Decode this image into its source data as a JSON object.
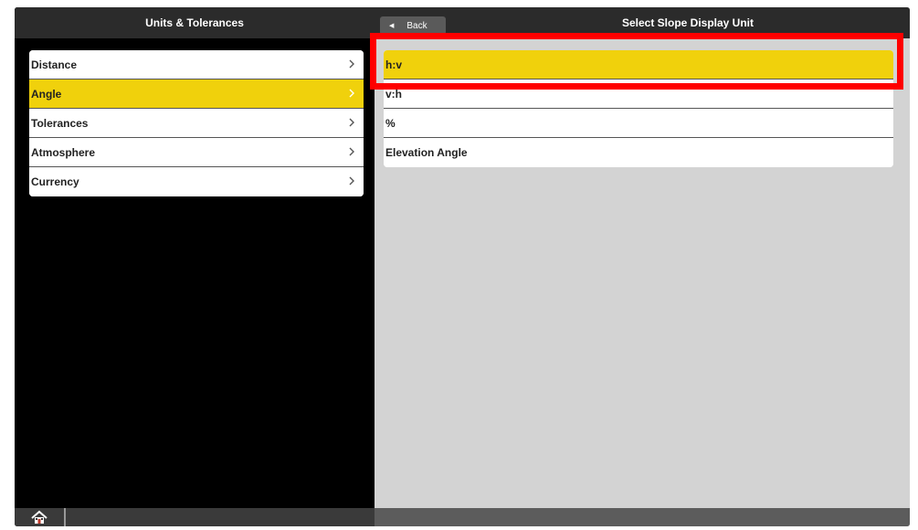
{
  "colors": {
    "selected": "#f0d10c",
    "header_bg": "#2b2b2b",
    "right_bg": "#d3d3d3",
    "highlight": "#ff0000"
  },
  "left_pane": {
    "title": "Units & Tolerances",
    "items": [
      {
        "label": "Distance",
        "selected": false
      },
      {
        "label": "Angle",
        "selected": true
      },
      {
        "label": "Tolerances",
        "selected": false
      },
      {
        "label": "Atmosphere",
        "selected": false
      },
      {
        "label": "Currency",
        "selected": false
      }
    ],
    "footer": {
      "home_icon": "home-icon"
    }
  },
  "right_pane": {
    "title": "Select Slope Display Unit",
    "back_label": "Back",
    "items": [
      {
        "label": "h:v",
        "selected": true
      },
      {
        "label": "v:h",
        "selected": false
      },
      {
        "label": "%",
        "selected": false
      },
      {
        "label": "Elevation Angle",
        "selected": false
      }
    ]
  }
}
